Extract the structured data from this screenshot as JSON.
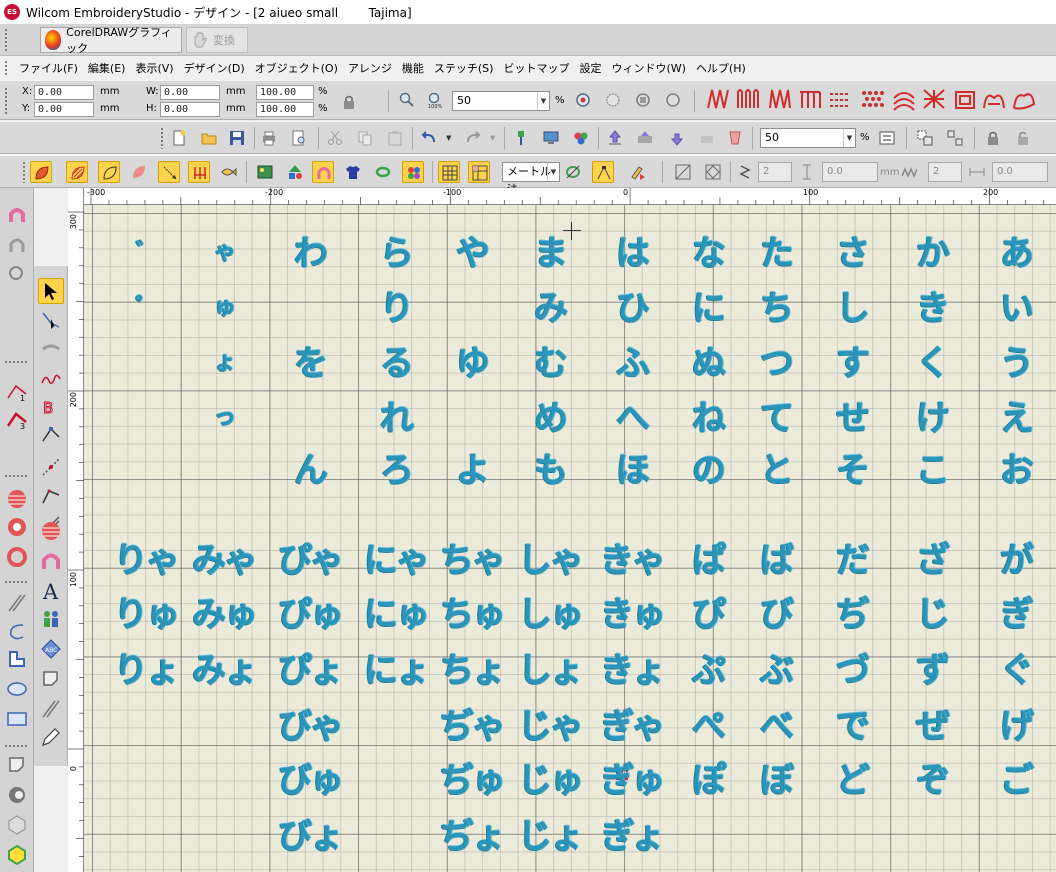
{
  "window": {
    "title": "Wilcom EmbroideryStudio - デザイン - [2 aiueo small        Tajima]",
    "logo_text": "ES"
  },
  "corel_strip": {
    "corel_label": "CorelDRAWグラフィック",
    "convert_label": "変換"
  },
  "menu": [
    {
      "label": "ファイル(F)"
    },
    {
      "label": "編集(E)"
    },
    {
      "label": "表示(V)"
    },
    {
      "label": "デザイン(D)"
    },
    {
      "label": "オブジェクト(O)"
    },
    {
      "label": "アレンジ"
    },
    {
      "label": "機能"
    },
    {
      "label": "ステッチ(S)"
    },
    {
      "label": "ビットマップ"
    },
    {
      "label": "設定"
    },
    {
      "label": "ウィンドウ(W)"
    },
    {
      "label": "ヘルプ(H)"
    }
  ],
  "properties": {
    "x_label": "X:",
    "x_value": "0.00",
    "y_label": "Y:",
    "y_value": "0.00",
    "w_label": "W:",
    "w_value": "0.00",
    "h_label": "H:",
    "h_value": "0.00",
    "unit_mm": "mm",
    "scale_w": "100.00",
    "scale_h": "100.00",
    "unit_pct": "%"
  },
  "zoom": {
    "value": "50",
    "unit": "%"
  },
  "toolbar2": {
    "stitch_value": "50",
    "unit": "%"
  },
  "toolbar3": {
    "method": "メートル法",
    "spin1": "2",
    "spin2": "0.0",
    "spin3": "2",
    "spin4": "0.0",
    "unit_mm": "mm"
  },
  "rulers": {
    "top": [
      "-300",
      "-200",
      "-100",
      "0",
      "100",
      "200"
    ],
    "left": [
      "300",
      "200",
      "100",
      "0"
    ]
  },
  "colors": {
    "thread": "#2a95b8",
    "active_tool": "#ffd34d",
    "canvas": "#ecead9"
  },
  "design": {
    "basic_rows": [
      [
        "あ",
        "か",
        "さ",
        "た",
        "な",
        "は",
        "ま",
        "や",
        "ら",
        "わ",
        "ゃ",
        "゛"
      ],
      [
        "い",
        "き",
        "し",
        "ち",
        "に",
        "ひ",
        "み",
        "",
        "り",
        "",
        "ゅ",
        "゜"
      ],
      [
        "う",
        "く",
        "す",
        "つ",
        "ぬ",
        "ふ",
        "む",
        "ゆ",
        "る",
        "を",
        "ょ",
        ""
      ],
      [
        "え",
        "け",
        "せ",
        "て",
        "ね",
        "へ",
        "め",
        "",
        "れ",
        "",
        "っ",
        ""
      ],
      [
        "お",
        "こ",
        "そ",
        "と",
        "の",
        "ほ",
        "も",
        "よ",
        "ろ",
        "ん",
        "",
        ""
      ]
    ],
    "combo_rows": [
      [
        "が",
        "ざ",
        "だ",
        "ば",
        "ぱ",
        "きゃ",
        "しゃ",
        "ちゃ",
        "にゃ",
        "ぴゃ",
        "みゃ",
        "りゃ"
      ],
      [
        "ぎ",
        "じ",
        "ぢ",
        "び",
        "ぴ",
        "きゅ",
        "しゅ",
        "ちゅ",
        "にゅ",
        "ぴゅ",
        "みゅ",
        "りゅ"
      ],
      [
        "ぐ",
        "ず",
        "づ",
        "ぶ",
        "ぷ",
        "きょ",
        "しょ",
        "ちょ",
        "にょ",
        "ぴょ",
        "みょ",
        "りょ"
      ],
      [
        "げ",
        "ぜ",
        "で",
        "べ",
        "ぺ",
        "ぎゃ",
        "じゃ",
        "ぢゃ",
        "",
        "びゃ",
        "",
        ""
      ],
      [
        "ご",
        "ぞ",
        "ど",
        "ぼ",
        "ぽ",
        "ぎゅ",
        "じゅ",
        "ぢゅ",
        "",
        "びゅ",
        "",
        ""
      ],
      [
        "",
        "",
        "",
        "",
        "",
        "ぎょ",
        "じょ",
        "ぢょ",
        "",
        "びょ",
        "",
        ""
      ]
    ]
  }
}
